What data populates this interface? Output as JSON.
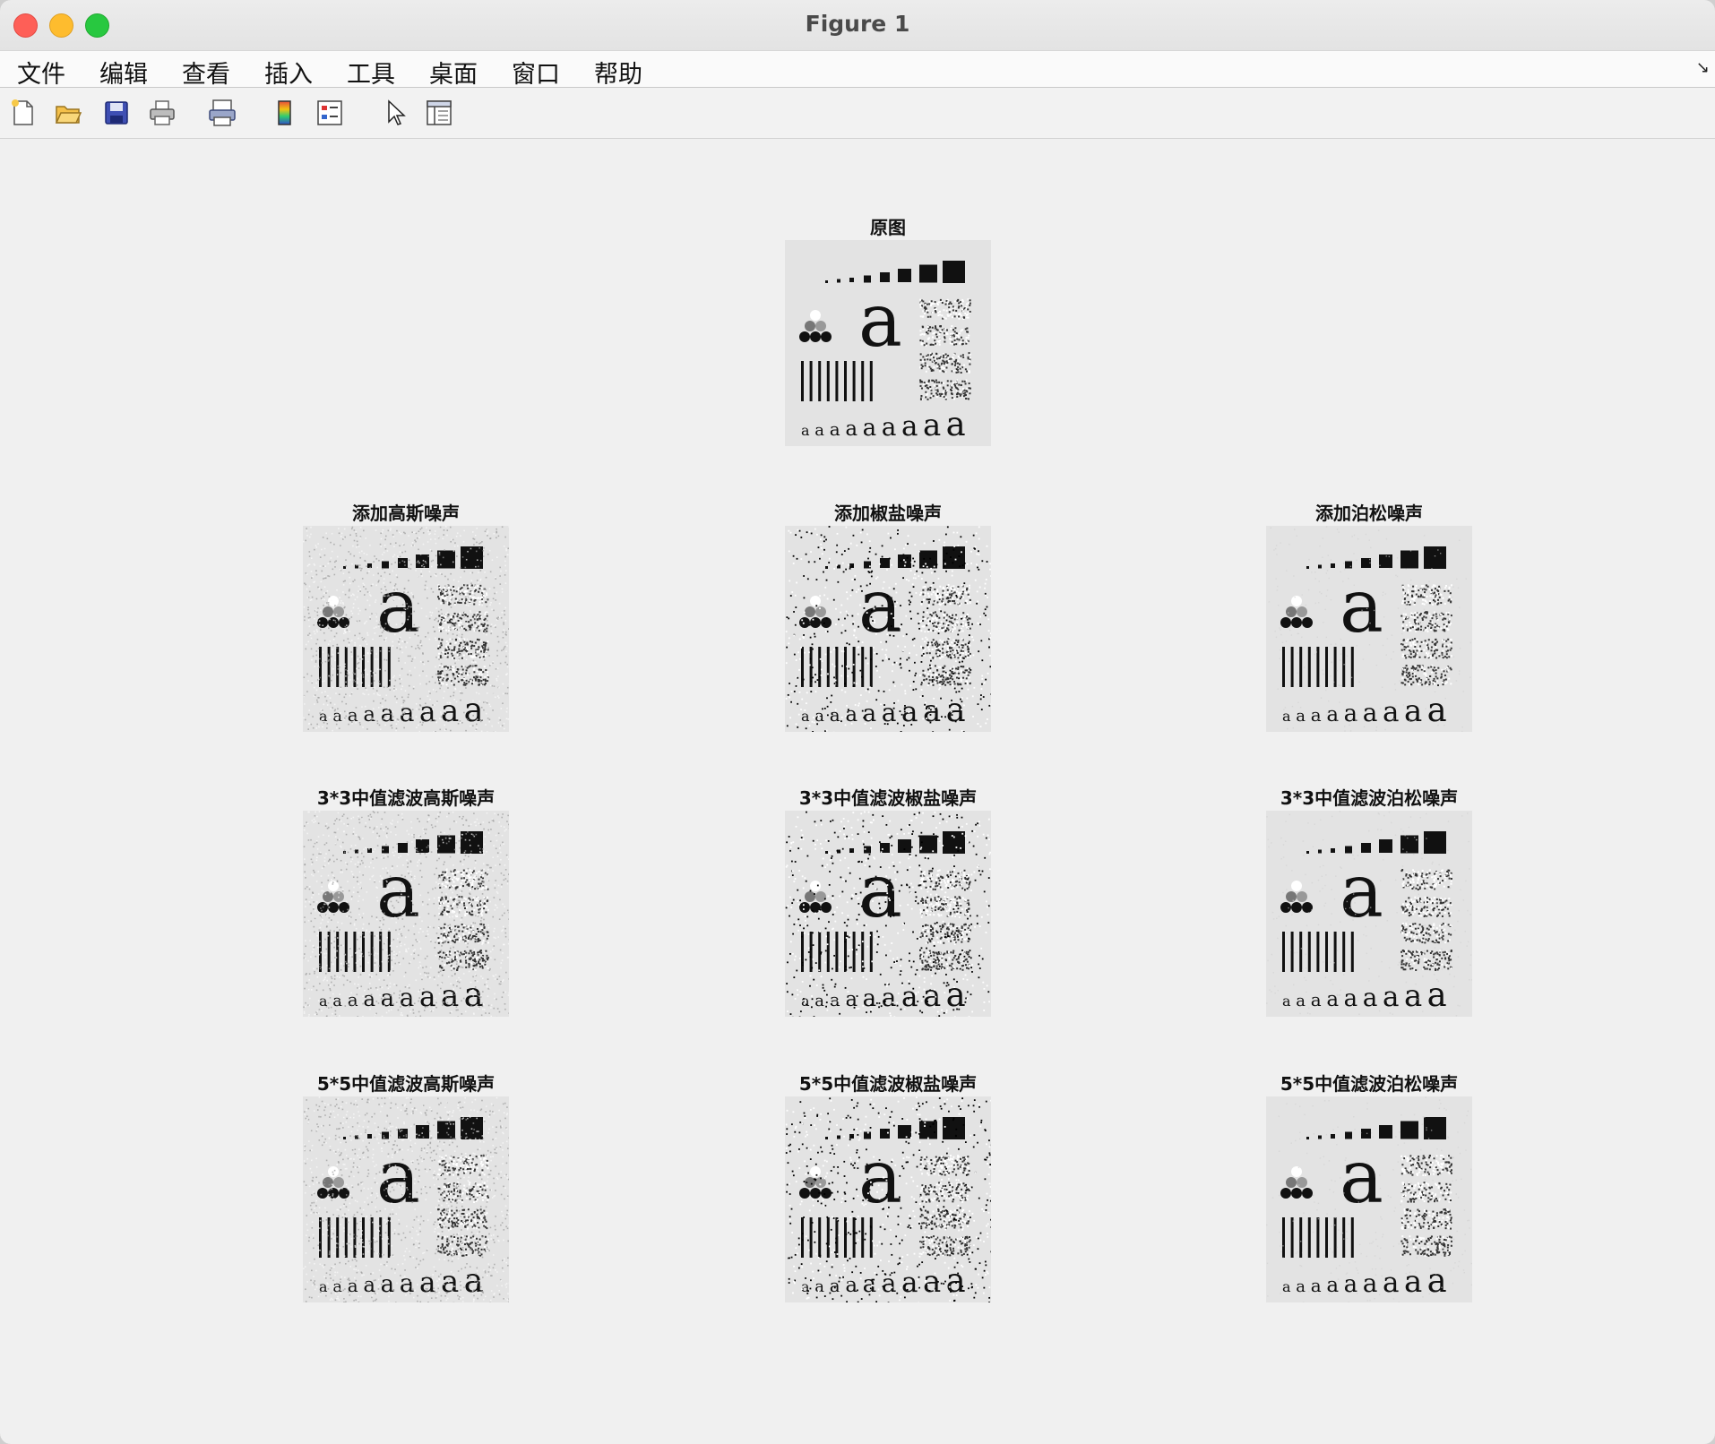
{
  "window": {
    "title": "Figure 1"
  },
  "menu": {
    "items": [
      "文件",
      "编辑",
      "查看",
      "插入",
      "工具",
      "桌面",
      "窗口",
      "帮助"
    ],
    "corner_glyph": "↘"
  },
  "toolbar": {
    "icons": [
      "new-figure-icon",
      "open-file-icon",
      "save-icon",
      "print-icon",
      "print-preview-icon",
      "colorbar-icon",
      "legend-icon",
      "pointer-icon",
      "property-inspector-icon"
    ]
  },
  "subplots": [
    {
      "title": "原图",
      "noise": "none"
    },
    {
      "title": "添加高斯噪声",
      "noise": "gaussian"
    },
    {
      "title": "添加椒盐噪声",
      "noise": "salt-pepper"
    },
    {
      "title": "添加泊松噪声",
      "noise": "poisson"
    },
    {
      "title": "3*3中值滤波高斯噪声",
      "noise": "gaussian"
    },
    {
      "title": "3*3中值滤波椒盐噪声",
      "noise": "salt-pepper"
    },
    {
      "title": "3*3中值滤波泊松噪声",
      "noise": "poisson"
    },
    {
      "title": "5*5中值滤波高斯噪声",
      "noise": "gaussian"
    },
    {
      "title": "5*5中值滤波椒盐噪声",
      "noise": "salt-pepper"
    },
    {
      "title": "5*5中值滤波泊松噪声",
      "noise": "poisson"
    }
  ],
  "test_image": {
    "glyph": "a"
  },
  "colors": {
    "window_bg": "#f0f0f0",
    "image_bg": "#e3e3e3",
    "ink": "#111111"
  }
}
